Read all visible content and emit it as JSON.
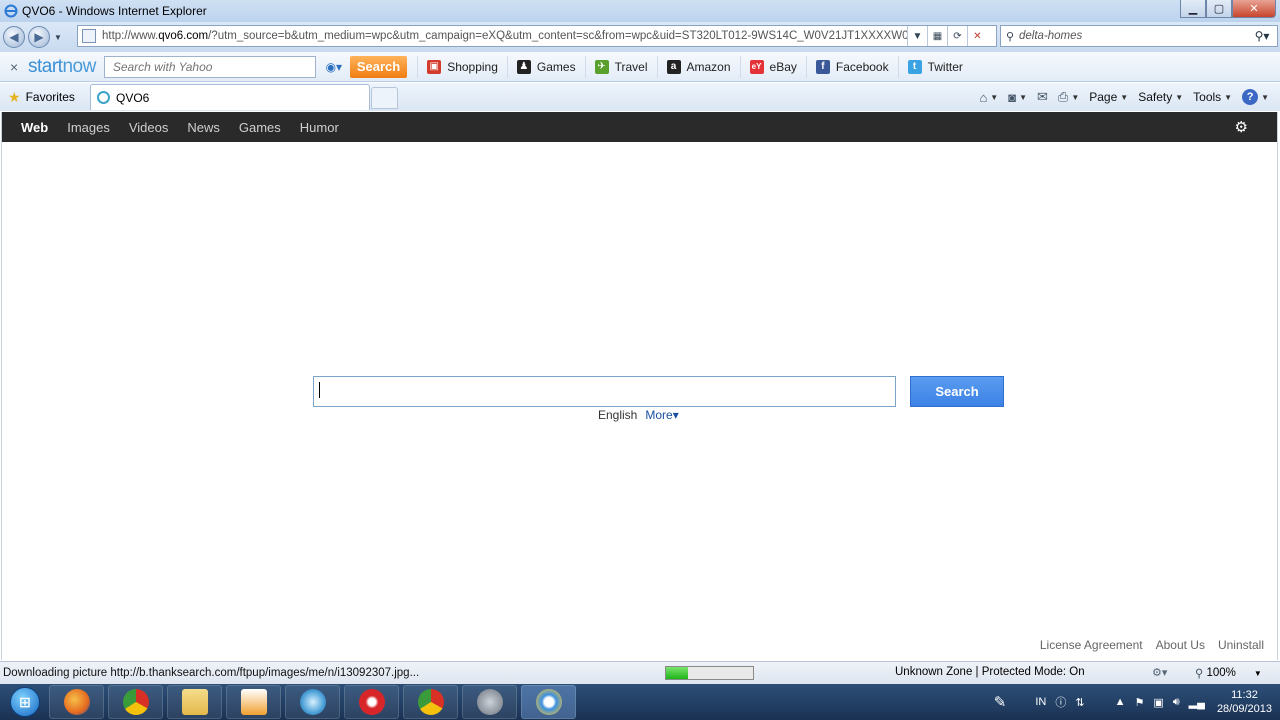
{
  "window": {
    "title": "QVO6 - Windows Internet Explorer"
  },
  "address_bar": {
    "url_prefix": "http://www.",
    "url_domain": "qvo6.com",
    "url_rest": "/?utm_source=b&utm_medium=wpc&utm_campaign=eXQ&utm_content=sc&from=wpc&uid=ST320LT012-9WS14C_W0V21JT1XXXXW0V2"
  },
  "ie_search": {
    "value": "delta-homes"
  },
  "startnow_toolbar": {
    "brand_start": "start",
    "brand_now": "now",
    "search_placeholder": "Search with Yahoo",
    "search_button": "Search",
    "links": [
      {
        "label": "Shopping",
        "icon": "shopping-bag-icon",
        "color": "#d33b2c"
      },
      {
        "label": "Games",
        "icon": "games-icon",
        "color": "#222222"
      },
      {
        "label": "Travel",
        "icon": "plane-icon",
        "color": "#5aa02c"
      },
      {
        "label": "Amazon",
        "icon": "amazon-icon",
        "color": "#222222"
      },
      {
        "label": "eBay",
        "icon": "ebay-icon",
        "color": "#e53238"
      },
      {
        "label": "Facebook",
        "icon": "facebook-icon",
        "color": "#3b5998"
      },
      {
        "label": "Twitter",
        "icon": "twitter-icon",
        "color": "#3aa3e3"
      }
    ]
  },
  "favorites_bar": {
    "favorites_label": "Favorites",
    "active_tab": "QVO6",
    "commands": {
      "page": "Page",
      "safety": "Safety",
      "tools": "Tools"
    }
  },
  "site_nav": {
    "items": [
      "Web",
      "Images",
      "Videos",
      "News",
      "Games",
      "Humor"
    ],
    "active": "Web"
  },
  "main_search": {
    "value": "",
    "button": "Search",
    "language": "English",
    "more": "More▾"
  },
  "footer": {
    "links": [
      "License Agreement",
      "About Us",
      "Uninstall"
    ]
  },
  "status_bar": {
    "message": "Downloading picture http://b.thanksearch.com/ftpup/images/me/n/i13092307.jpg...",
    "progress": 0.25,
    "zone": "Unknown Zone | Protected Mode: On",
    "zoom": "100%"
  },
  "taskbar": {
    "language": "IN",
    "time": "11:32",
    "date": "28/09/2013",
    "apps": [
      {
        "name": "firefox",
        "color": "#e66a1f"
      },
      {
        "name": "chrome",
        "color": "#3a9b3a"
      },
      {
        "name": "file-explorer",
        "color": "#e8c25a"
      },
      {
        "name": "media-player",
        "color": "#f0a030"
      },
      {
        "name": "app-circle",
        "color": "#4aa0d8"
      },
      {
        "name": "app-red",
        "color": "#d8252a"
      },
      {
        "name": "chrome-2",
        "color": "#3a9b3a"
      },
      {
        "name": "app-gray",
        "color": "#8a8f96"
      },
      {
        "name": "internet-explorer",
        "color": "#3b8fe0"
      }
    ]
  }
}
